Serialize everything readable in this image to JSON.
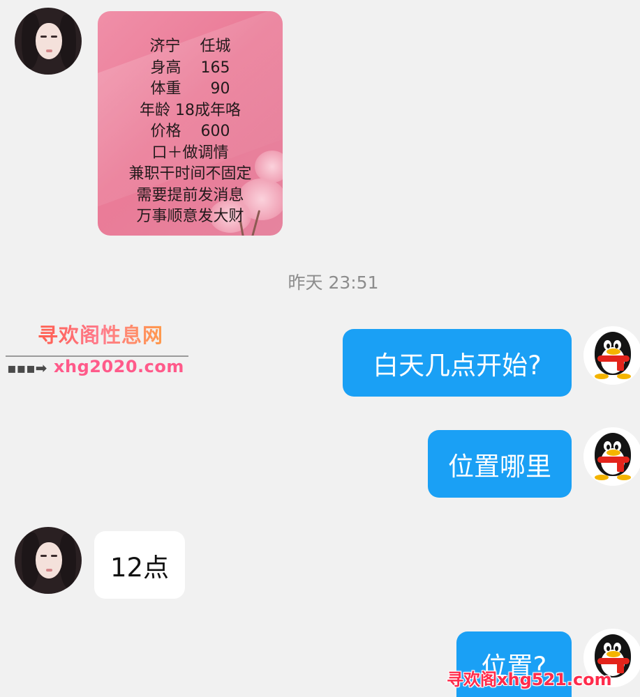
{
  "conversation": {
    "image_message": {
      "lines": [
        "济宁    任城",
        "身高    165",
        "体重      90",
        "年龄 18成年咯",
        "价格    600",
        "口＋做调情",
        "兼职干时间不固定",
        "需要提前发消息",
        "万事顺意发大财"
      ]
    },
    "timestamp": "昨天 23:51",
    "messages": [
      {
        "sender": "me",
        "text": "白天几点开始?"
      },
      {
        "sender": "me",
        "text": "位置哪里"
      },
      {
        "sender": "other",
        "text": "12点"
      },
      {
        "sender": "me",
        "text": "位置?"
      }
    ]
  },
  "watermark": {
    "title": "寻欢阁性息网",
    "url": "xhg2020.com",
    "bottom": "寻欢阁xhg521.com"
  },
  "colors": {
    "background": "#f1f1f1",
    "my_bubble": "#1aa0f5",
    "their_bubble": "#ffffff",
    "timestamp_text": "#8c8c8c"
  },
  "icons": {
    "contact_avatar": "avatar-female",
    "my_avatar": "qq-penguin-icon"
  }
}
